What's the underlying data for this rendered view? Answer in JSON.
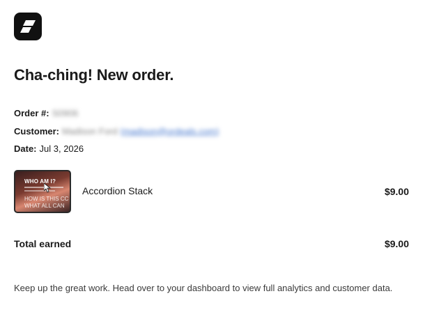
{
  "logo": {
    "icon": "store-logo-icon",
    "bg": "#111111"
  },
  "headline": "Cha-ching! New order.",
  "order": {
    "number_label": "Order #:",
    "number_value": "S0906",
    "customer_label": "Customer:",
    "customer_name": "Madison Ford",
    "customer_email": "(madison@ordeals.com)",
    "date_label": "Date:",
    "date_value": "Jul 3, 2026"
  },
  "product": {
    "thumb_title": "WHO AM I?",
    "thumb_line1": "HOW IS THIS CC",
    "thumb_line2": "WHAT ALL CAN",
    "name": "Accordion Stack",
    "price": "$9.00"
  },
  "total": {
    "label": "Total earned",
    "amount": "$9.00"
  },
  "footer": "Keep up the great work. Head over to your dashboard to view full analytics and customer data."
}
